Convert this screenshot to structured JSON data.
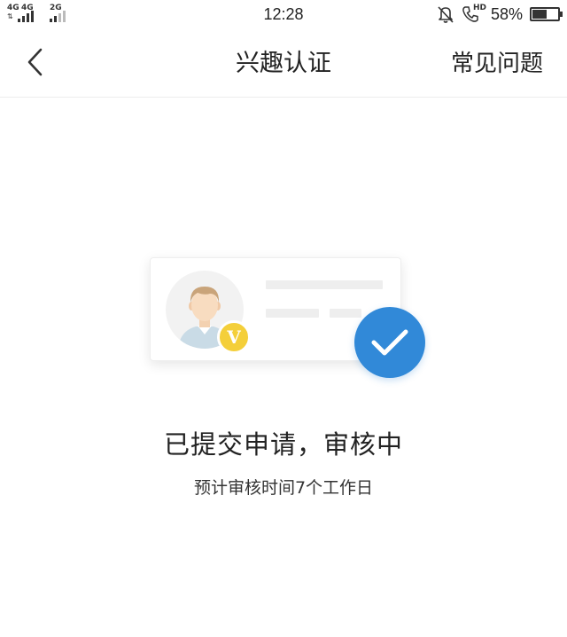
{
  "status_bar": {
    "network_1": "4G",
    "network_2": "4G",
    "network_3": "2G",
    "time": "12:28",
    "hd_label": "HD",
    "battery_percent": "58%",
    "battery_level": 0.58,
    "icons": [
      "mute-bell-icon",
      "hd-call-icon",
      "battery-icon"
    ]
  },
  "nav": {
    "back_icon": "chevron-left-icon",
    "title": "兴趣认证",
    "faq_label": "常见问题"
  },
  "illustration": {
    "badge_letter": "V",
    "check_icon": "checkmark-icon",
    "colors": {
      "check_bg": "#3189d8",
      "badge_bg": "#f4cf3a",
      "avatar_bg": "#f2f2f2"
    }
  },
  "content": {
    "heading": "已提交申请，审核中",
    "subtext": "预计审核时间7个工作日"
  }
}
